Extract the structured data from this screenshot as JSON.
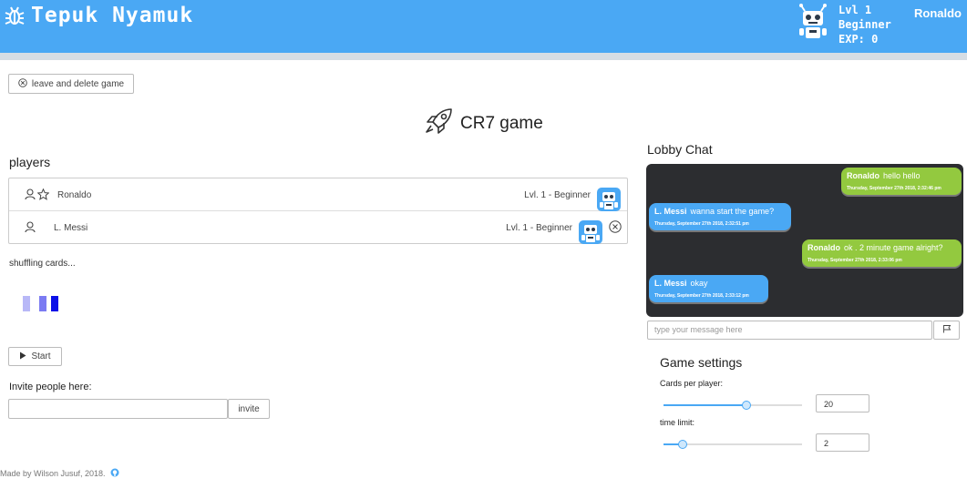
{
  "header": {
    "app_title": "Tepuk Nyamuk",
    "level": "Lvl 1",
    "rank": "Beginner",
    "exp": "EXP: 0",
    "username": "Ronaldo"
  },
  "leave_button": "leave and delete game",
  "game_title": "CR7 game",
  "players": {
    "heading": "players",
    "rows": [
      {
        "name": "Ronaldo",
        "level": "Lvl. 1 - Beginner"
      },
      {
        "name": "L. Messi",
        "level": "Lvl. 1 - Beginner"
      }
    ]
  },
  "status": "shuffling cards...",
  "start_button": "Start",
  "invite": {
    "label": "Invite people here:",
    "value": "",
    "button": "invite"
  },
  "footer": "Made by Wilson Jusuf, 2018.",
  "chat": {
    "heading": "Lobby Chat",
    "messages": [
      {
        "user": "Ronaldo",
        "text": "hello hello",
        "time": "Thursday, September 27th 2018, 2:32:46 pm"
      },
      {
        "user": "L. Messi",
        "text": "wanna start the game?",
        "time": "Thursday, September 27th 2018, 2:32:51 pm"
      },
      {
        "user": "Ronaldo",
        "text": "ok . 2 minute game alright?",
        "time": "Thursday, September 27th 2018, 2:33:06 pm"
      },
      {
        "user": "L. Messi",
        "text": "okay",
        "time": "Thursday, September 27th 2018, 2:33:12 pm"
      }
    ],
    "input_placeholder": "type your message here"
  },
  "settings": {
    "heading": "Game settings",
    "cards_label": "Cards per player:",
    "cards_value": "20",
    "cards_fraction": 0.6,
    "time_label": "time limit:",
    "time_value": "2",
    "time_fraction": 0.14
  },
  "colors": {
    "brand": "#4aa8f4",
    "own_message": "#93c93f",
    "other_message": "#4aa8f4",
    "chat_bg": "#2c2d30"
  }
}
